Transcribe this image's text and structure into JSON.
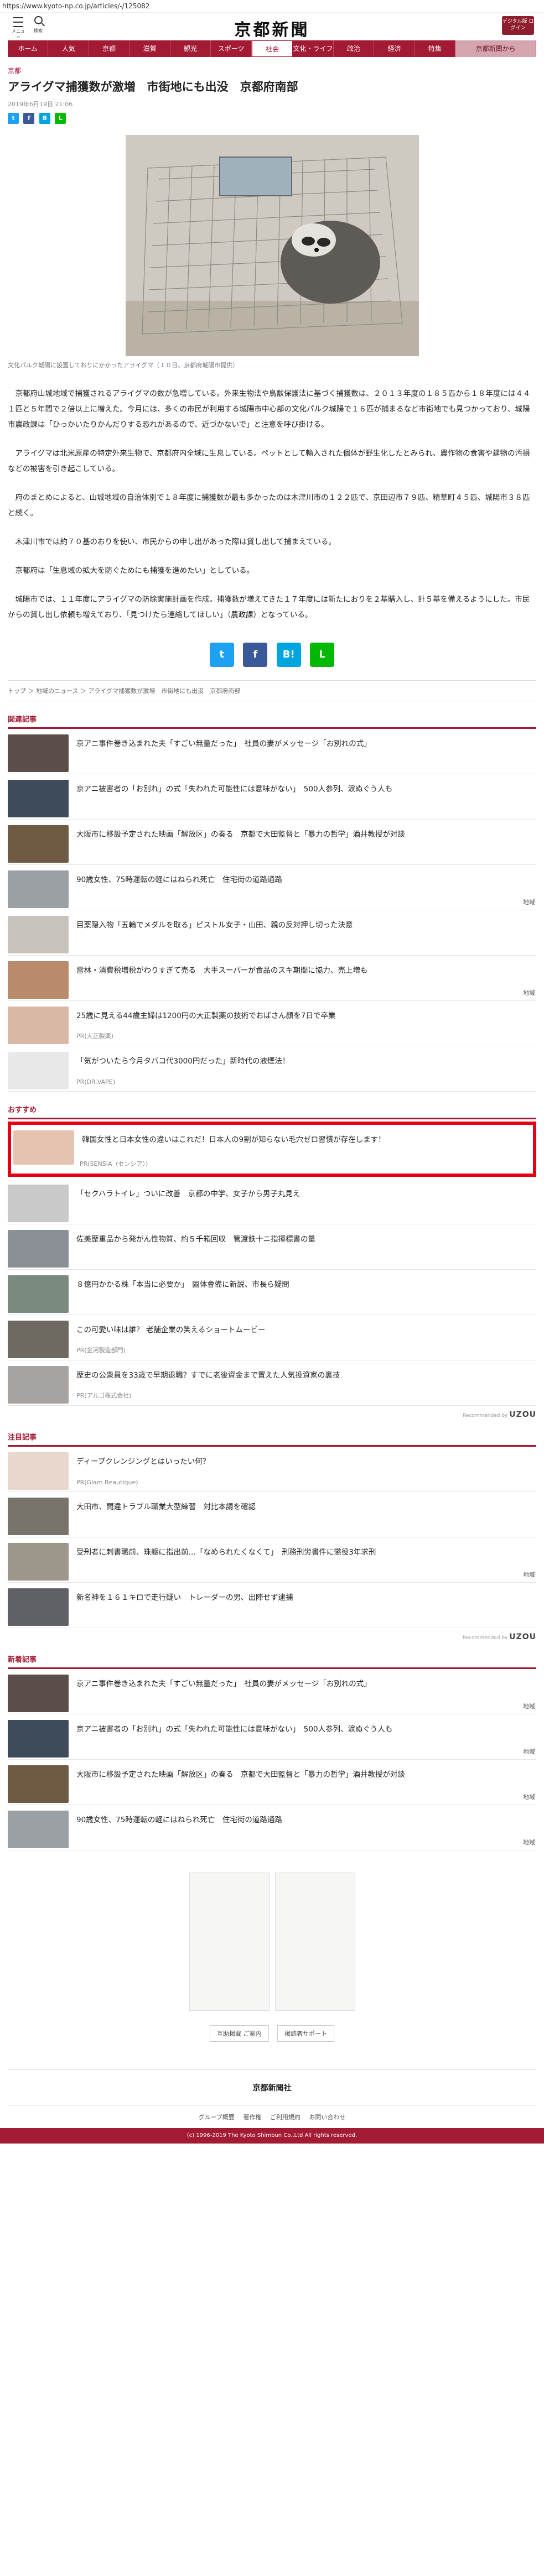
{
  "url": "https://www.kyoto-np.co.jp/articles/-/125082",
  "header": {
    "menu_label": "メニュー",
    "search_label": "検索",
    "logo": "京都新聞",
    "digital_label": "デジタル版 ログイン"
  },
  "nav": [
    "ホーム",
    "人気",
    "京都",
    "滋賀",
    "観光",
    "スポーツ",
    "社会",
    "文化・ライフ",
    "政治",
    "経済",
    "特集",
    "京都新聞から"
  ],
  "article": {
    "section": "京都",
    "title": "アライグマ捕獲数が激増　市街地にも出没　京都府南部",
    "date": "2019年6月19日 21:06",
    "caption": "文化パルク城陽に設置しておりにかかったアライグマ（１０日、京都府城陽市提供）",
    "paragraphs": [
      "京都府山城地域で捕獲されるアライグマの数が急増している。外来生物法や鳥獣保護法に基づく捕獲数は、２０１３年度の１８５匹から１８年度には４４１匹と５年間で２倍以上に増えた。今月には、多くの市民が利用する城陽市中心部の文化パルク城陽で１６匹が捕まるなど市街地でも見つかっており、城陽市農政課は「ひっかいたりかんだりする恐れがあるので、近づかないで」と注意を呼び掛ける。",
      "アライグマは北米原産の特定外来生物で、京都府内全域に生息している。ペットとして輸入された個体が野生化したとみられ、農作物の食害や建物の汚損などの被害を引き起こしている。",
      "府のまとめによると、山城地域の自治体別で１８年度に捕獲数が最も多かったのは木津川市の１２２匹で、京田辺市７９匹、精華町４５匹、城陽市３８匹と続く。",
      "木津川市では約７０基のおりを使い、市民からの申し出があった際は貸し出して捕まえている。",
      "京都府は「生息域の拡大を防ぐためにも捕獲を進めたい」としている。",
      "城陽市では、１１年度にアライグマの防除実施計画を作成。捕獲数が増えてきた１７年度には新たにおりを２基購入し、計５基を備えるようにした。市民からの貸し出し依頼も増えており、「見つけたら連絡してほしい」（農政課）となっている。"
    ]
  },
  "breadcrumb": "トップ ＞ 地域のニュース ＞ アライグマ捕獲数が激増　市街地にも出没　京都府南部",
  "related": {
    "title": "関連記事",
    "items": [
      {
        "title": "京アニ事件巻き込まれた夫「すごい無量だった」　社員の妻がメッセージ「お別れの式」",
        "tag": ""
      },
      {
        "title": "京アニ被害者の「お別れ」の式「失われた可能性には意味がない」　500人参列、涙ぬぐう人も",
        "tag": ""
      },
      {
        "title": "大阪市に移設予定された映画「解放区」の奏る　京都で大田監督と「暴力の哲学」酒井教授が対談",
        "tag": ""
      },
      {
        "title": "90歳女性、75時運転の軽にはねられ死亡　住宅街の道路通路",
        "tag": "地域"
      },
      {
        "title": "目薬隠入物「五輪でメダルを取る」ピストル女子・山田、親の反対押し切った決意",
        "tag": ""
      },
      {
        "title": "雷林・消費税増税がわりすぎて売る　大手スーパーが食品のスキ期間に協力、売上増も",
        "tag": "地域"
      },
      {
        "title": "25歳に見える44歳主婦は1200円の大正製薬の技術でおばさん顔を7日で卒業",
        "tag": "",
        "pr": "PR(大正製薬)"
      },
      {
        "title": "「気がついたら今月タバコ代3000円だった」新時代の液煙法！",
        "tag": "",
        "pr": "PR(DR.VAPE)"
      }
    ]
  },
  "recommend": {
    "title": "おすすめ",
    "items": [
      {
        "title": "韓国女性と日本女性の違いはこれだ！日本人の9割が知らない毛穴ゼロ習慣が存在します！",
        "pr": "PR(SENSIA（センシア）)",
        "highlight": true
      },
      {
        "title": "「セクハラトイレ」ついに改善　京都の中学、女子から男子丸見え",
        "pr": ""
      },
      {
        "title": "佐美歴重品から発がん性物質、約５千箱回収　管渡鉄十ニ指揮標書の量",
        "pr": ""
      },
      {
        "title": "８億円かかる株「本当に必要か」　固体會備に新説、市長ら疑問",
        "pr": ""
      },
      {
        "title": "この可愛い味は誰？ 老舗企業の笑えるショートムービー",
        "pr": "PR(金河製造部門)"
      },
      {
        "title": "歴史の公衆員を33歳で早期退職？すでに老後資金まで置えた人気投資家の裏技",
        "pr": "PR(アルゴ株式会社)"
      }
    ],
    "powered": "Recommended by",
    "powered_brand": "UZOU"
  },
  "notable": {
    "title": "注目記事",
    "items": [
      {
        "title": "ディープクレンジングとはいったい何？",
        "pr": "PR(Glam Beautique)",
        "tag": ""
      },
      {
        "title": "大田市、間違トラブル職業大型練習　対比本請を確認",
        "pr": "",
        "tag": ""
      },
      {
        "title": "受刑者に刺書職前、珠躯に指出前…「なめられたくなくて」　刑務刑労書件に懲役3年求刑",
        "pr": "",
        "tag": "地域"
      },
      {
        "title": "新名神を１６１キロで走行疑い　トレーダーの男、出陣せず逮捕",
        "pr": "",
        "tag": ""
      }
    ],
    "powered": "Recommended by",
    "powered_brand": "UZOU"
  },
  "latest": {
    "title": "新着記事",
    "items": [
      {
        "title": "京アニ事件巻き込まれた夫「すごい無量だった」　社員の妻がメッセージ「お別れの式」",
        "tag": "地域"
      },
      {
        "title": "京アニ被害者の「お別れ」の式「失われた可能性には意味がない」　500人参列、涙ぬぐう人も",
        "tag": "地域"
      },
      {
        "title": "大阪市に移設予定された映画「解放区」の奏る　京都で大田監督と「暴力の哲学」酒井教授が対談",
        "tag": "地域"
      },
      {
        "title": "90歳女性、75時運転の軽にはねられ死亡　住宅街の道路通路",
        "tag": "地域"
      }
    ]
  },
  "ad_links": [
    "互助掲載 ご案内",
    "掲読者サポート"
  ],
  "footer": {
    "logo": "京都新聞社",
    "links": [
      "グループ概要",
      "著作権",
      "ご利用規約",
      "お問い合わせ"
    ],
    "copyright": "(c) 1996-2019 The Kyoto Shimbun Co.,Ltd All rights reserved."
  },
  "colors": {
    "brand": "#a31a34",
    "highlight_border": "#e60012"
  }
}
